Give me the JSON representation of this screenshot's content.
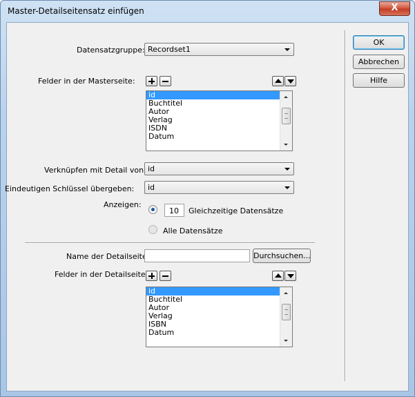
{
  "window": {
    "title": "Master-Detailseitensatz einfügen",
    "close_label": "X"
  },
  "recordset": {
    "label": "Datensatzgruppe:",
    "value": "Recordset1"
  },
  "master_fields": {
    "label": "Felder in der Masterseite:",
    "items": [
      "id",
      "Buchtitel",
      "Autor",
      "Verlag",
      "ISDN",
      "Datum"
    ],
    "selected_index": 0
  },
  "link_detail": {
    "label": "Verknüpfen mit Detail von:",
    "value": "id"
  },
  "unique_key": {
    "label": "Eindeutigen Schlüssel übergeben:",
    "value": "id"
  },
  "show": {
    "label": "Anzeigen:",
    "count_value": "10",
    "option_count_label": "Gleichzeitige Datensätze",
    "option_all_label": "Alle Datensätze",
    "selected": "count"
  },
  "detail_page": {
    "label": "Name der Detailseite:",
    "value": "",
    "browse_label": "Durchsuchen..."
  },
  "detail_fields": {
    "label": "Felder in der Detailseite:",
    "items": [
      "id",
      "Buchtitel",
      "Autor",
      "Verlag",
      "ISBN",
      "Datum"
    ],
    "selected_index": 0
  },
  "buttons": {
    "ok": "OK",
    "cancel": "Abbrechen",
    "help": "Hilfe"
  },
  "colors": {
    "selection": "#3399ff",
    "dialog_bg": "#f0f0f0",
    "titlebar": "#b9d2ec"
  }
}
